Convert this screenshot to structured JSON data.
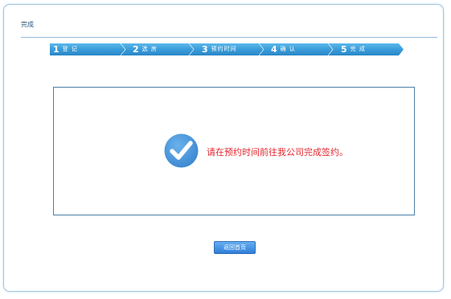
{
  "page": {
    "title": "完成"
  },
  "steps": [
    {
      "num": "1",
      "label": "登 记"
    },
    {
      "num": "2",
      "label": "选 房"
    },
    {
      "num": "3",
      "label": "预约时间"
    },
    {
      "num": "4",
      "label": "确 认"
    },
    {
      "num": "5",
      "label": "完 成"
    }
  ],
  "result": {
    "message": "请在预约时间前往我公司完成签约。",
    "icon": "checkmark-circle-icon"
  },
  "actions": {
    "home_label": "返回首页"
  },
  "colors": {
    "accent": "#3f8fd2",
    "message": "#e3262d",
    "step_bar": "#3fa0dc"
  }
}
